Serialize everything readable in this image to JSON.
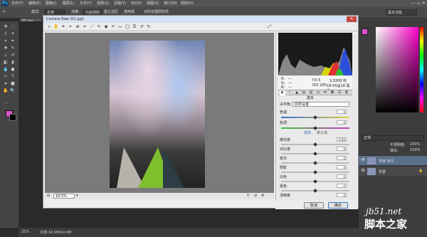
{
  "menubar": {
    "logo": "Ps",
    "items": [
      "文件(F)",
      "编辑(E)",
      "图像(I)",
      "图层(L)",
      "文字(Y)",
      "选择(S)",
      "滤镜(T)",
      "3D(D)",
      "视图(V)",
      "窗口(W)",
      "帮助(H)"
    ],
    "window_controls": "—  ▭  ✕"
  },
  "options": {
    "mode_label": "模式:",
    "mode_value": "正常",
    "flow_label": "流量:",
    "btn1": "内容感知",
    "btn2": "建立选区",
    "btn3": "使用源",
    "checkbox": "对所有图层取样",
    "workspace": "基本功能"
  },
  "document": {
    "tab": "01.jpg"
  },
  "toolbar_icons": [
    "move-icon",
    "marquee-icon",
    "lasso-icon",
    "quick-select-icon",
    "crop-icon",
    "eyedropper-icon",
    "healing-icon",
    "brush-icon",
    "stamp-icon",
    "history-brush-icon",
    "eraser-icon",
    "gradient-icon",
    "blur-icon",
    "dodge-icon",
    "pen-icon",
    "type-icon",
    "path-select-icon",
    "shape-icon",
    "hand-icon",
    "zoom-icon"
  ],
  "camera_raw": {
    "title": "Camera Raw (01.jpg)",
    "close": "✕",
    "tools": [
      "🔍",
      "✋",
      "✒",
      "⌖",
      "✂",
      "⟲",
      "✎",
      "◐",
      "⬚",
      "☰",
      "⟳",
      "⟲"
    ],
    "zoom": "18.5%",
    "camera_info": {
      "r": "R:",
      "g": "G:",
      "b": "B:",
      "r_val": "---",
      "g_val": "---",
      "b_val": "---",
      "aperture": "f/3.5",
      "shutter": "1/3200 秒",
      "iso": "ISO 200",
      "focal": "18-55@18 毫米"
    },
    "panel_title": "基本",
    "white_balance_label": "白平衡:",
    "white_balance_value": "原照设置",
    "sliders1": [
      {
        "label": "色温",
        "value": "0"
      },
      {
        "label": "色调",
        "value": "0"
      }
    ],
    "auto": "自动",
    "default": "默认值",
    "sliders2": [
      {
        "label": "曝光度",
        "value": "0.00"
      },
      {
        "label": "对比度",
        "value": "0"
      },
      {
        "label": "高光",
        "value": "0"
      },
      {
        "label": "阴影",
        "value": "0"
      },
      {
        "label": "白色",
        "value": "0"
      },
      {
        "label": "黑色",
        "value": "0"
      }
    ],
    "saturation_label": "清晰度",
    "saturation_value": "0",
    "cancel": "取消",
    "ok": "确定"
  },
  "layers": {
    "mode": "正常",
    "opacity_label": "不透明度:",
    "opacity": "100%",
    "fill_label": "填充:",
    "fill": "100%",
    "layer1": "背景 拷贝",
    "layer2": "背景"
  },
  "status": {
    "zoom": "25%",
    "doc": "文档:14.9M/14.9M"
  },
  "watermark": {
    "site": "jb51.net",
    "name": "脚本之家"
  }
}
